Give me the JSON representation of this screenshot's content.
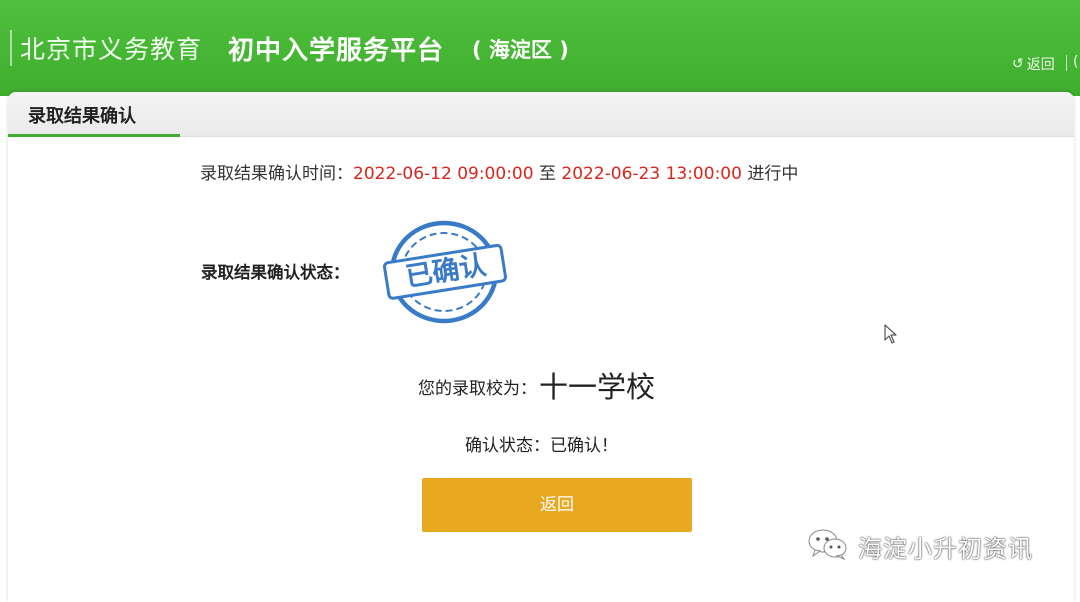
{
  "header": {
    "title_light": "北京市义务教育",
    "title_bold": "初中入学服务平台",
    "district": "( 海淀区 )",
    "back_label": "返回",
    "return_icon": "return-arrow-icon",
    "edge_fragment": "(",
    "bg_color": "#3fae2e"
  },
  "panel": {
    "tab_label": "录取结果确认",
    "accent_color": "#3fae2e"
  },
  "confirm_time": {
    "label": "录取结果确认时间：",
    "start": "2022-06-12 09:00:00",
    "connector": " 至 ",
    "end": "2022-06-23 13:00:00",
    "status": " 进行中",
    "highlight_color": "#d9261c"
  },
  "status_block": {
    "label": "录取结果确认状态：",
    "stamp_text": "已确认",
    "stamp_color": "#3a7bc8"
  },
  "result": {
    "school_label": "您的录取校为：",
    "school_name": "十一学校",
    "confirm_status": "确认状态：已确认！"
  },
  "buttons": {
    "return_label": "返回",
    "return_color": "#e8a921"
  },
  "watermark": {
    "text": "海淀小升初资讯",
    "icon": "wechat-icon"
  }
}
